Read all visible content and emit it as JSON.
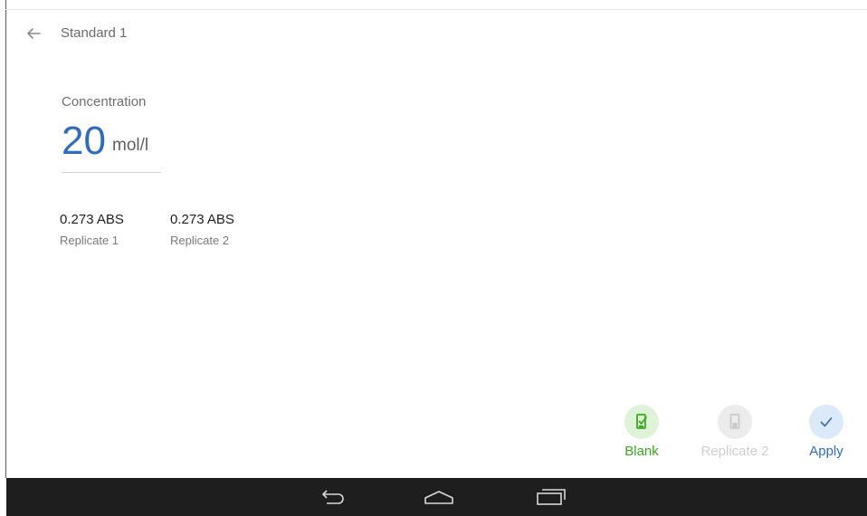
{
  "appbar": {
    "title": "Standard 1",
    "back_icon": "arrow-left-icon"
  },
  "concentration": {
    "label": "Concentration",
    "value": "20",
    "unit": "mol/l"
  },
  "replicates": [
    {
      "value": "0.273 ABS",
      "label": "Replicate 1"
    },
    {
      "value": "0.273 ABS",
      "label": "Replicate 2"
    }
  ],
  "actions": {
    "blank": {
      "label": "Blank",
      "icon": "cuvette-blank-icon",
      "color": "#3aaa1c",
      "bg": "#dff3d8",
      "enabled": true
    },
    "replicate2": {
      "label": "Replicate 2",
      "icon": "cuvette-icon",
      "color": "#cfcfcf",
      "bg": "#ececec",
      "enabled": false
    },
    "apply": {
      "label": "Apply",
      "icon": "check-icon",
      "color": "#2f6cc0",
      "bg": "#dbe9f8",
      "enabled": true
    }
  },
  "navbar": {
    "icons": [
      "nav-back-icon",
      "nav-home-icon",
      "nav-recents-icon"
    ]
  },
  "colors": {
    "accent_blue": "#2f6cc0",
    "accent_green": "#3aaa1c",
    "navbar_bg": "#1e1e1e"
  }
}
